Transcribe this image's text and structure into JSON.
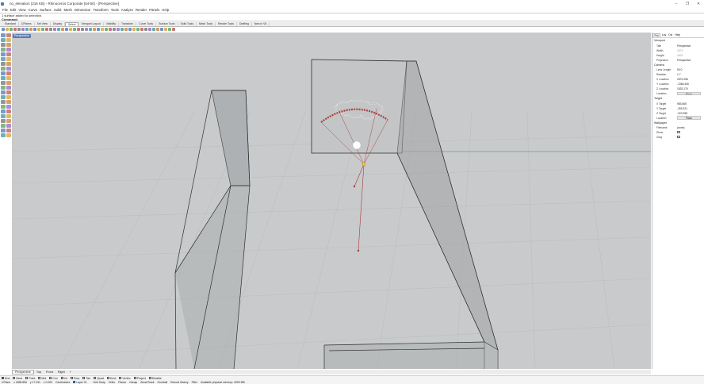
{
  "window": {
    "title": "no_elevation (216 KB) - Rhinoceros Corporate (64-bit) - [Perspective]",
    "minimize": "–",
    "maximize": "❐",
    "close": "✕"
  },
  "menu": [
    "File",
    "Edit",
    "View",
    "Curve",
    "Surface",
    "Solid",
    "Mesh",
    "Dimension",
    "Transform",
    "Tools",
    "Analyze",
    "Render",
    "Panels",
    "Help"
  ],
  "command_history": {
    "line1": "1 surface added to selection.",
    "prompt": "Command:"
  },
  "toolbar_tabs": [
    {
      "label": "Standard"
    },
    {
      "label": "CPlanes"
    },
    {
      "label": "Set View"
    },
    {
      "label": "Display"
    },
    {
      "label": "Select",
      "active": true
    },
    {
      "label": "Viewport Layout"
    },
    {
      "label": "Visibility"
    },
    {
      "label": "Transform"
    },
    {
      "label": "Curve Tools"
    },
    {
      "label": "Surface Tools"
    },
    {
      "label": "Solid Tools"
    },
    {
      "label": "Mesh Tools"
    },
    {
      "label": "Render Tools"
    },
    {
      "label": "Drafting"
    },
    {
      "label": "New in V5"
    }
  ],
  "viewport": {
    "label": "Perspective"
  },
  "panel": {
    "tabs": [
      {
        "label": "Pro",
        "active": true
      },
      {
        "label": "Lay"
      },
      {
        "label": "Dis"
      },
      {
        "label": "Help"
      }
    ],
    "sections": {
      "viewport": {
        "title": "Viewport",
        "rows": [
          {
            "key": "Title",
            "value": "Perspective"
          },
          {
            "key": "Width",
            "value": "3073",
            "dim": true
          },
          {
            "key": "Height",
            "value": "1609",
            "dim": true
          },
          {
            "key": "Projection",
            "value": "Perspective"
          }
        ]
      },
      "camera": {
        "title": "Camera",
        "rows": [
          {
            "key": "Lens Length",
            "value": "50.0"
          },
          {
            "key": "Rotation",
            "value": "1.7"
          },
          {
            "key": "X Location",
            "value": "2679.256"
          },
          {
            "key": "Y Location",
            "value": "-1366.406"
          },
          {
            "key": "Z Location",
            "value": "1533.170"
          },
          {
            "key": "Location",
            "value": "Place",
            "button": true
          }
        ]
      },
      "target": {
        "title": "Target",
        "rows": [
          {
            "key": "X Target",
            "value": "983.665"
          },
          {
            "key": "Y Target",
            "value": "-259.221"
          },
          {
            "key": "Z Target",
            "value": "-220.998"
          },
          {
            "key": "Location",
            "value": "Place",
            "button": true
          }
        ]
      },
      "wallpaper": {
        "title": "Wallpaper",
        "rows": [
          {
            "key": "Filename",
            "value": "(none)"
          },
          {
            "key": "Show",
            "value": "",
            "checkbox": true
          },
          {
            "key": "Gray",
            "value": "",
            "checkbox": true
          }
        ]
      }
    }
  },
  "viewport_tabs": [
    {
      "label": "Perspective",
      "active": true
    },
    {
      "label": "Top"
    },
    {
      "label": "Front"
    },
    {
      "label": "Right"
    },
    {
      "label": "+"
    }
  ],
  "osnaps": [
    {
      "label": "End",
      "on": true
    },
    {
      "label": "Near",
      "on": false
    },
    {
      "label": "Point",
      "on": false
    },
    {
      "label": "Mid",
      "on": false
    },
    {
      "label": "Cen",
      "on": false
    },
    {
      "label": "Int",
      "on": false
    },
    {
      "label": "Perp",
      "on": false
    },
    {
      "label": "Tan",
      "on": false
    },
    {
      "label": "Quad",
      "on": false
    },
    {
      "label": "Knot",
      "on": false
    },
    {
      "label": "Vertex",
      "on": false
    },
    {
      "label": "Project",
      "on": false
    },
    {
      "label": "Disable",
      "on": false
    }
  ],
  "status": {
    "cplane": "CPlane",
    "x": "x 1658.896",
    "y": "y 17.331",
    "z": "z 0.000",
    "units": "Centimeters",
    "layer": "Layer 01",
    "items": [
      "Grid Snap",
      "Ortho",
      "Planar",
      "Osnap",
      "SmartTrack",
      "Gumball",
      "Record History",
      "Filter",
      "Available physical memory: 4993 MB"
    ]
  },
  "colors": {
    "viewport_bg": "#c9cacb",
    "grid_line": "#b9babb",
    "axis_green": "#5fa35f",
    "axis_red": "#c25a5a",
    "camera_line": "#a23c3c",
    "arc_red": "#a8423e",
    "viewport_label_bg": "#5b7db0"
  },
  "icons": {
    "toolbar_icons": [
      "new-file-icon",
      "open-icon",
      "save-icon",
      "print-icon",
      "cut-icon",
      "copy-icon",
      "paste-icon",
      "undo-icon",
      "pan-icon",
      "rotate-icon",
      "zoom-icon",
      "select-icon",
      "layer-icon",
      "render-icon"
    ],
    "left_tools": [
      "point-icon",
      "polyline-icon",
      "curve-icon",
      "circle-icon",
      "arc-icon",
      "rectangle-icon",
      "polygon-icon",
      "surface-icon",
      "extrude-icon",
      "box-icon",
      "sphere-icon",
      "boolean-icon",
      "fillet-icon",
      "trim-icon",
      "split-icon",
      "join-icon",
      "move-icon",
      "copy-icon",
      "rotate-icon",
      "scale-icon",
      "mirror-icon",
      "array-icon",
      "dimension-icon",
      "text-icon"
    ]
  }
}
